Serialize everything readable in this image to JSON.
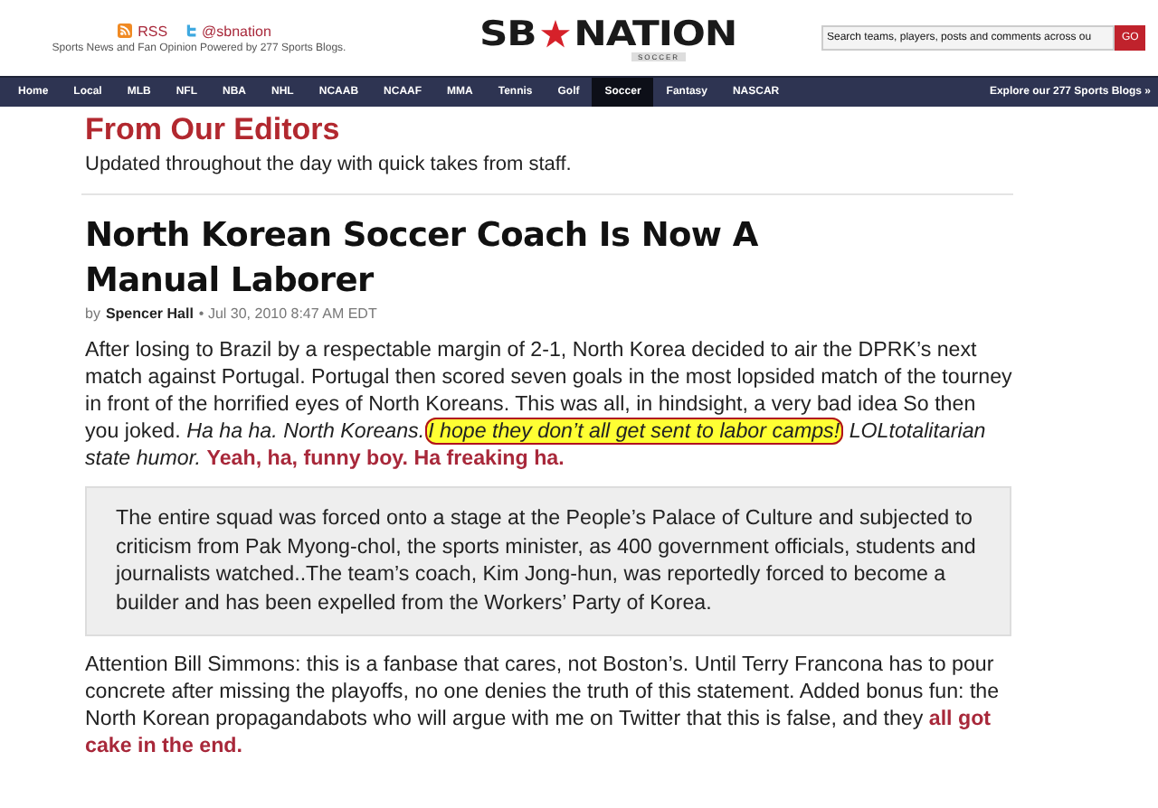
{
  "header": {
    "rss": "RSS",
    "twitter": "@sbnation",
    "tagline": "Sports News and Fan Opinion Powered by 277 Sports Blogs.",
    "logo_left": "SB",
    "logo_right": "NATION",
    "logo_sub": "SOCCER",
    "search": {
      "placeholder": "Search teams, players, posts and comments across ou"
    },
    "go": "GO"
  },
  "nav": {
    "items": [
      {
        "label": "Home",
        "selected": false
      },
      {
        "label": "Local",
        "selected": false
      },
      {
        "label": "MLB",
        "selected": false
      },
      {
        "label": "NFL",
        "selected": false
      },
      {
        "label": "NBA",
        "selected": false
      },
      {
        "label": "NHL",
        "selected": false
      },
      {
        "label": "NCAAB",
        "selected": false
      },
      {
        "label": "NCAAF",
        "selected": false
      },
      {
        "label": "MMA",
        "selected": false
      },
      {
        "label": "Tennis",
        "selected": false
      },
      {
        "label": "Golf",
        "selected": false
      },
      {
        "label": "Soccer",
        "selected": true
      },
      {
        "label": "Fantasy",
        "selected": false
      },
      {
        "label": "NASCAR",
        "selected": false
      }
    ],
    "explore": "Explore our 277 Sports Blogs »"
  },
  "section": {
    "title": "From Our Editors",
    "subtitle": "Updated throughout the day with quick takes from staff."
  },
  "article": {
    "headline": "North Korean Soccer Coach Is Now A Manual Laborer",
    "byline": {
      "prefix": "by",
      "author": "Spencer Hall",
      "date": "• Jul 30, 2010 8:47 AM EDT"
    },
    "body": [
      {
        "kind": "paragraph",
        "segments": [
          {
            "kind": "text",
            "text": "After losing to Brazil by a respectable margin of 2-1, North Korea decided to air the DPRK’s next match against Portugal. Portugal then scored seven goals in the most lopsided match of the tourney in front of the horrified eyes of North Koreans. This was all, in hindsight, a very bad idea So then you joked. *Ha ha ha. North Koreans.*"
          },
          {
            "kind": "highlight",
            "text": "I hope they don’t all get sent to labor camps!"
          },
          {
            "kind": "text",
            "text": " *LOLtotalitarian state humor.* **Yeah, ha, funny boy. Ha freaking ha.**"
          }
        ]
      },
      {
        "kind": "quote",
        "segments": [
          {
            "kind": "text",
            "text": "The entire squad was forced onto a stage at the People’s Palace of Culture and subjected to criticism from Pak Myong-chol, the sports minister, as 400 government officials, students and journalists watched..The team’s coach, Kim Jong-hun, was reportedly forced to become a builder and has been expelled from the Workers’ Party of Korea."
          }
        ]
      },
      {
        "kind": "paragraph",
        "segments": [
          {
            "kind": "text",
            "text": "Attention Bill Simmons: this is a fanbase that cares, not Boston’s. Until Terry Francona has to pour concrete after missing the playoffs, no one denies the truth of this statement. Added bonus fun: the North Korean propagandabots who will argue with me on Twitter that this is false, and they **all got cake in the end.**"
          }
        ]
      }
    ]
  }
}
